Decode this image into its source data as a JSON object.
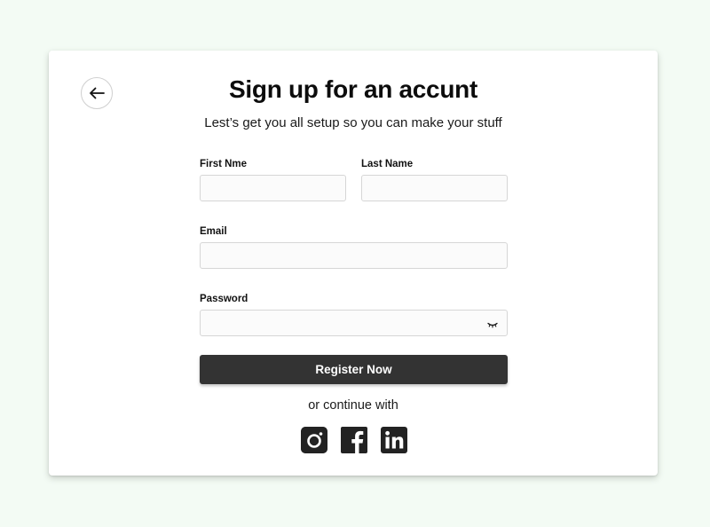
{
  "header": {
    "back_icon": "arrow-left-icon",
    "title": "Sign up for an accunt",
    "subtitle": "Lest’s get you all setup so you can make your stuff"
  },
  "form": {
    "first_name": {
      "label": "First Nme",
      "value": ""
    },
    "last_name": {
      "label": "Last Name",
      "value": ""
    },
    "email": {
      "label": "Email",
      "value": ""
    },
    "password": {
      "label": "Password",
      "value": "",
      "toggle_icon": "eye-closed-icon"
    },
    "submit_label": "Register Now"
  },
  "social": {
    "divider_text": "or continue with",
    "providers": [
      {
        "name": "instagram",
        "icon": "instagram-icon"
      },
      {
        "name": "facebook",
        "icon": "facebook-icon"
      },
      {
        "name": "linkedin",
        "icon": "linkedin-icon"
      }
    ]
  },
  "colors": {
    "page_background": "#f3fbf4",
    "card_background": "#ffffff",
    "button_background": "#333333",
    "button_text": "#ffffff",
    "icon_color": "#222222"
  }
}
